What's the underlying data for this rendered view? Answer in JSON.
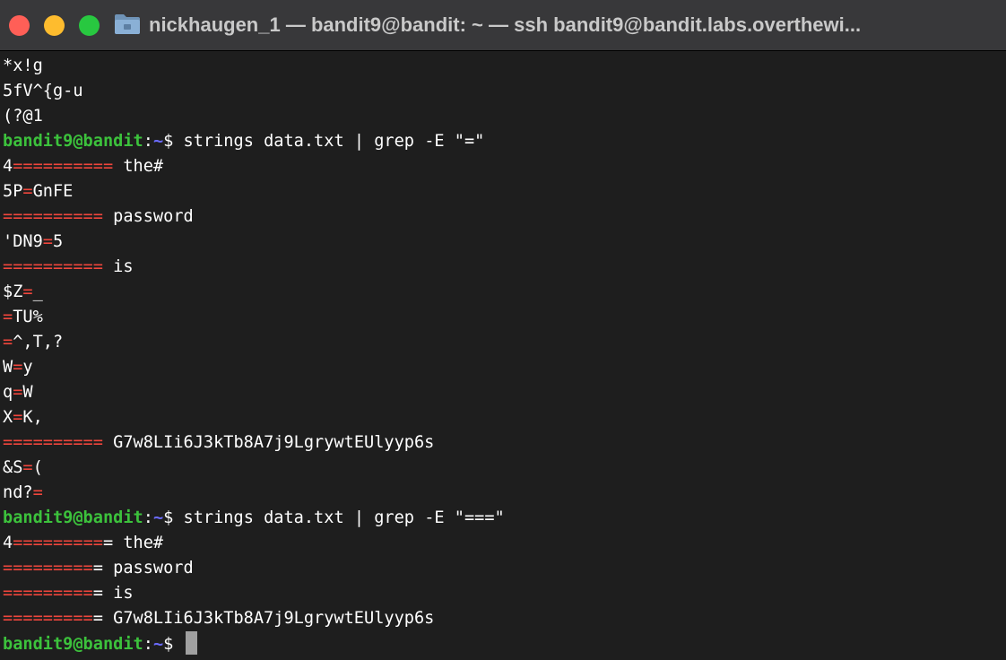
{
  "window": {
    "title": "nickhaugen_1 — bandit9@bandit: ~ — ssh bandit9@bandit.labs.overthewi..."
  },
  "terminal": {
    "lines": [
      {
        "segments": [
          {
            "text": "*x!g",
            "style": "plain"
          }
        ]
      },
      {
        "segments": [
          {
            "text": "5fV^{g-u",
            "style": "plain"
          }
        ]
      },
      {
        "segments": [
          {
            "text": "(?@1",
            "style": "plain"
          }
        ]
      },
      {
        "segments": [
          {
            "text": "bandit9@bandit",
            "style": "user"
          },
          {
            "text": ":",
            "style": "plain"
          },
          {
            "text": "~",
            "style": "path"
          },
          {
            "text": "$ strings data.txt | grep -E \"=\"",
            "style": "plain"
          }
        ]
      },
      {
        "segments": [
          {
            "text": "4",
            "style": "plain"
          },
          {
            "text": "==========",
            "style": "match"
          },
          {
            "text": " the#",
            "style": "plain"
          }
        ]
      },
      {
        "segments": [
          {
            "text": "5P",
            "style": "plain"
          },
          {
            "text": "=",
            "style": "match"
          },
          {
            "text": "GnFE",
            "style": "plain"
          }
        ]
      },
      {
        "segments": [
          {
            "text": "==========",
            "style": "match"
          },
          {
            "text": " password",
            "style": "plain"
          }
        ]
      },
      {
        "segments": [
          {
            "text": "'DN9",
            "style": "plain"
          },
          {
            "text": "=",
            "style": "match"
          },
          {
            "text": "5",
            "style": "plain"
          }
        ]
      },
      {
        "segments": [
          {
            "text": "==========",
            "style": "match"
          },
          {
            "text": " is",
            "style": "plain"
          }
        ]
      },
      {
        "segments": [
          {
            "text": "$Z",
            "style": "plain"
          },
          {
            "text": "=",
            "style": "match"
          },
          {
            "text": "_",
            "style": "plain"
          }
        ]
      },
      {
        "segments": [
          {
            "text": "=",
            "style": "match"
          },
          {
            "text": "TU%",
            "style": "plain"
          }
        ]
      },
      {
        "segments": [
          {
            "text": "=",
            "style": "match"
          },
          {
            "text": "^,T,?",
            "style": "plain"
          }
        ]
      },
      {
        "segments": [
          {
            "text": "W",
            "style": "plain"
          },
          {
            "text": "=",
            "style": "match"
          },
          {
            "text": "y",
            "style": "plain"
          }
        ]
      },
      {
        "segments": [
          {
            "text": "q",
            "style": "plain"
          },
          {
            "text": "=",
            "style": "match"
          },
          {
            "text": "W",
            "style": "plain"
          }
        ]
      },
      {
        "segments": [
          {
            "text": "X",
            "style": "plain"
          },
          {
            "text": "=",
            "style": "match"
          },
          {
            "text": "K,",
            "style": "plain"
          }
        ]
      },
      {
        "segments": [
          {
            "text": "==========",
            "style": "match"
          },
          {
            "text": " G7w8LIi6J3kTb8A7j9LgrywtEUlyyp6s",
            "style": "plain"
          }
        ]
      },
      {
        "segments": [
          {
            "text": "&S",
            "style": "plain"
          },
          {
            "text": "=",
            "style": "match"
          },
          {
            "text": "(",
            "style": "plain"
          }
        ]
      },
      {
        "segments": [
          {
            "text": "nd?",
            "style": "plain"
          },
          {
            "text": "=",
            "style": "match"
          }
        ]
      },
      {
        "segments": [
          {
            "text": "bandit9@bandit",
            "style": "user"
          },
          {
            "text": ":",
            "style": "plain"
          },
          {
            "text": "~",
            "style": "path"
          },
          {
            "text": "$ strings data.txt | grep -E \"===\"",
            "style": "plain"
          }
        ]
      },
      {
        "segments": [
          {
            "text": "4",
            "style": "plain"
          },
          {
            "text": "=========",
            "style": "match"
          },
          {
            "text": "= the#",
            "style": "plain"
          }
        ]
      },
      {
        "segments": [
          {
            "text": "=========",
            "style": "match"
          },
          {
            "text": "= password",
            "style": "plain"
          }
        ]
      },
      {
        "segments": [
          {
            "text": "=========",
            "style": "match"
          },
          {
            "text": "= is",
            "style": "plain"
          }
        ]
      },
      {
        "segments": [
          {
            "text": "=========",
            "style": "match"
          },
          {
            "text": "= G7w8LIi6J3kTb8A7j9LgrywtEUlyyp6s",
            "style": "plain"
          }
        ]
      },
      {
        "segments": [
          {
            "text": "bandit9@bandit",
            "style": "user"
          },
          {
            "text": ":",
            "style": "plain"
          },
          {
            "text": "~",
            "style": "path"
          },
          {
            "text": "$ ",
            "style": "plain"
          }
        ],
        "cursor": true
      }
    ]
  }
}
